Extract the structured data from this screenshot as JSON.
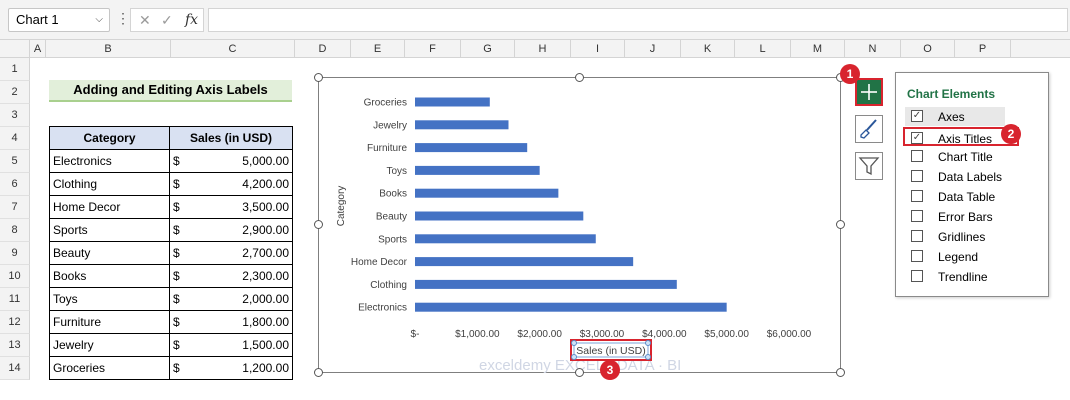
{
  "formula_bar": {
    "name_box": "Chart 1",
    "cancel_glyph": "✕",
    "enter_glyph": "✓",
    "fx_glyph": "fx",
    "formula": ""
  },
  "columns": [
    "A",
    "B",
    "C",
    "D",
    "E",
    "F",
    "G",
    "H",
    "I",
    "J",
    "K",
    "L",
    "M",
    "N",
    "O",
    "P"
  ],
  "rows": [
    "1",
    "2",
    "3",
    "4",
    "5",
    "6",
    "7",
    "8",
    "9",
    "10",
    "11",
    "12",
    "13",
    "14"
  ],
  "sheet": {
    "title": "Adding and Editing Axis Labels",
    "headers": {
      "category": "Category",
      "sales": "Sales (in USD)"
    },
    "currency_symbol": "$",
    "rows": [
      {
        "category": "Electronics",
        "sales": "5,000.00"
      },
      {
        "category": "Clothing",
        "sales": "4,200.00"
      },
      {
        "category": "Home Decor",
        "sales": "3,500.00"
      },
      {
        "category": "Sports",
        "sales": "2,900.00"
      },
      {
        "category": "Beauty",
        "sales": "2,700.00"
      },
      {
        "category": "Books",
        "sales": "2,300.00"
      },
      {
        "category": "Toys",
        "sales": "2,000.00"
      },
      {
        "category": "Furniture",
        "sales": "1,800.00"
      },
      {
        "category": "Jewelry",
        "sales": "1,500.00"
      },
      {
        "category": "Groceries",
        "sales": "1,200.00"
      }
    ]
  },
  "chart_data": {
    "type": "bar",
    "orientation": "horizontal",
    "categories": [
      "Electronics",
      "Clothing",
      "Home Decor",
      "Sports",
      "Beauty",
      "Books",
      "Toys",
      "Furniture",
      "Jewelry",
      "Groceries"
    ],
    "values": [
      5000,
      4200,
      3500,
      2900,
      2700,
      2300,
      2000,
      1800,
      1500,
      1200
    ],
    "title": "",
    "xlabel": "Sales (in USD)",
    "ylabel": "Category",
    "xlim": [
      0,
      6000
    ],
    "x_ticks": [
      "$-",
      "$1,000.00",
      "$2,000.00",
      "$3,000.00",
      "$4,000.00",
      "$5,000.00",
      "$6,000.00"
    ],
    "bar_color": "#4472c4",
    "grid": false,
    "legend": "none",
    "watermark": "exceldemy EXCEL · DATA · BI"
  },
  "chart_buttons": {
    "elements_icon": "plus-icon",
    "styles_icon": "paintbrush-icon",
    "filters_icon": "funnel-icon"
  },
  "chart_elements_panel": {
    "title": "Chart Elements",
    "items": [
      {
        "label": "Axes",
        "checked": true
      },
      {
        "label": "Axis Titles",
        "checked": true
      },
      {
        "label": "Chart Title",
        "checked": false
      },
      {
        "label": "Data Labels",
        "checked": false
      },
      {
        "label": "Data Table",
        "checked": false
      },
      {
        "label": "Error Bars",
        "checked": false
      },
      {
        "label": "Gridlines",
        "checked": false
      },
      {
        "label": "Legend",
        "checked": false
      },
      {
        "label": "Trendline",
        "checked": false
      }
    ]
  },
  "callouts": [
    "1",
    "2",
    "3"
  ],
  "colors": {
    "accent_green": "#217346",
    "callout_red": "#d8242e",
    "header_fill": "#d9e1f2",
    "title_fill": "#e2efda"
  }
}
